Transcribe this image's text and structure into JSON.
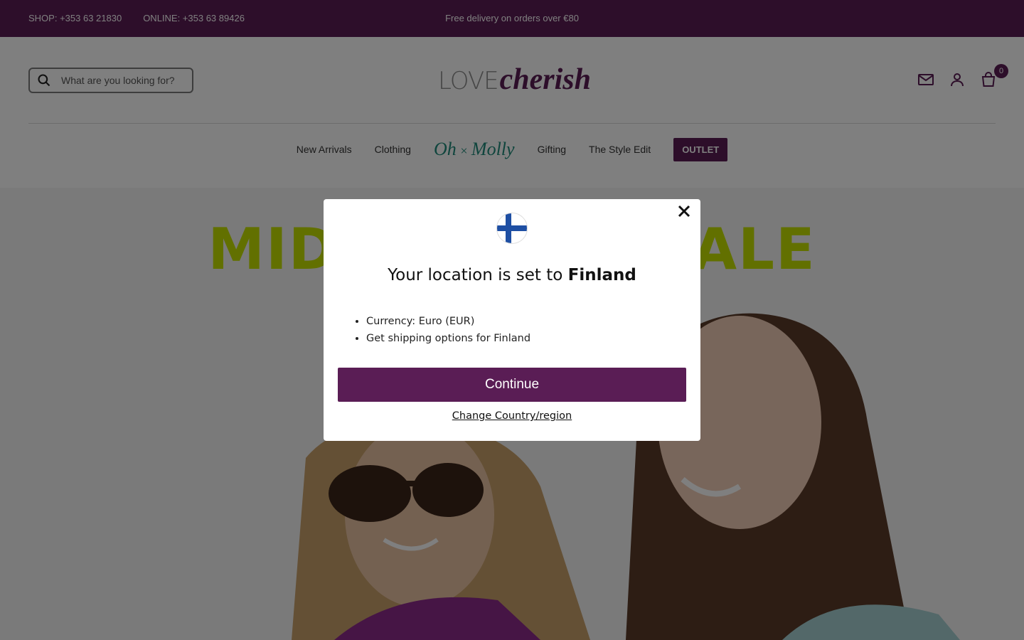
{
  "topbar": {
    "shop_phone": "SHOP: +353 63 21830",
    "online_phone": "ONLINE: +353 63 89426",
    "promo": "Free delivery on orders over €80"
  },
  "header": {
    "search_placeholder": "What are you looking for?",
    "logo_love": "LOVE",
    "logo_cherish": "cherish",
    "cart_count": "0"
  },
  "nav": {
    "items": [
      "New Arrivals",
      "Clothing",
      "Gifting",
      "The Style Edit"
    ],
    "brand_oh": "Oh",
    "brand_molly": "Molly",
    "outlet": "OUTLET"
  },
  "hero": {
    "headline_left": "MID",
    "headline_right": "ALE"
  },
  "modal": {
    "title_prefix": "Your location is set to",
    "country": "Finland",
    "bullets": [
      "Currency: Euro (EUR)",
      "Get shipping options for Finland"
    ],
    "continue_label": "Continue",
    "change_label": "Change Country/region"
  },
  "colors": {
    "brand": "#5a1d55",
    "accent_lime": "#c4e000",
    "flag_blue": "#1e4fa3"
  }
}
